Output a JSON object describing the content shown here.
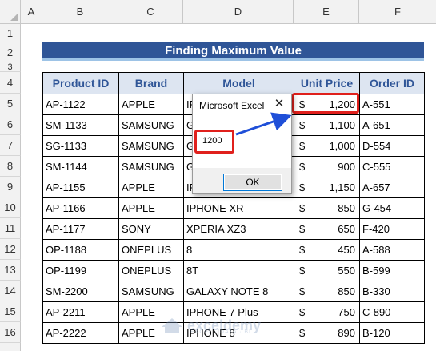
{
  "columns": [
    "A",
    "B",
    "C",
    "D",
    "E",
    "F"
  ],
  "rows": [
    "1",
    "2",
    "3",
    "4",
    "5",
    "6",
    "7",
    "8",
    "9",
    "10",
    "11",
    "12",
    "13",
    "14",
    "15",
    "16"
  ],
  "title": "Finding Maximum Value",
  "headers": {
    "product_id": "Product ID",
    "brand": "Brand",
    "model": "Model",
    "unit_price": "Unit Price",
    "order_id": "Order ID"
  },
  "table": [
    {
      "product_id": "AP-1122",
      "brand": "APPLE",
      "model": "IP",
      "currency": "$",
      "price": "1,200",
      "order_id": "A-551"
    },
    {
      "product_id": "SM-1133",
      "brand": "SAMSUNG",
      "model": "G",
      "currency": "$",
      "price": "1,100",
      "order_id": "A-651"
    },
    {
      "product_id": "SG-1133",
      "brand": "SAMSUNG",
      "model": "G",
      "currency": "$",
      "price": "1,000",
      "order_id": "D-554"
    },
    {
      "product_id": "SM-1144",
      "brand": "SAMSUNG",
      "model": "G",
      "currency": "$",
      "price": "900",
      "order_id": "C-555"
    },
    {
      "product_id": "AP-1155",
      "brand": "APPLE",
      "model": "IP",
      "currency": "$",
      "price": "1,150",
      "order_id": "A-657"
    },
    {
      "product_id": "AP-1166",
      "brand": "APPLE",
      "model": "IPHONE XR",
      "currency": "$",
      "price": "850",
      "order_id": "G-454"
    },
    {
      "product_id": "AP-1177",
      "brand": "SONY",
      "model": "XPERIA XZ3",
      "currency": "$",
      "price": "650",
      "order_id": "F-420"
    },
    {
      "product_id": "OP-1188",
      "brand": "ONEPLUS",
      "model": "8",
      "currency": "$",
      "price": "450",
      "order_id": "A-588"
    },
    {
      "product_id": "OP-1199",
      "brand": "ONEPLUS",
      "model": "8T",
      "currency": "$",
      "price": "550",
      "order_id": "B-599"
    },
    {
      "product_id": "SM-2200",
      "brand": "SAMSUNG",
      "model": "GALAXY NOTE 8",
      "currency": "$",
      "price": "850",
      "order_id": "B-330"
    },
    {
      "product_id": "AP-2211",
      "brand": "APPLE",
      "model": "IPHONE 7 Plus",
      "currency": "$",
      "price": "750",
      "order_id": "C-890"
    },
    {
      "product_id": "AP-2222",
      "brand": "APPLE",
      "model": "IPHONE 8",
      "currency": "$",
      "price": "890",
      "order_id": "B-120"
    }
  ],
  "dialog": {
    "title": "Microsoft Excel",
    "close": "✕",
    "message": "1200",
    "ok": "OK"
  },
  "watermark": {
    "brand": "exceldemy",
    "tagline": "EXCEL · DATA · BI"
  },
  "colors": {
    "title_bg": "#2f5597",
    "header_bg": "#dde5f1",
    "header_text": "#2f5597",
    "highlight": "#e0201c",
    "arrow": "#1f4fd8"
  }
}
